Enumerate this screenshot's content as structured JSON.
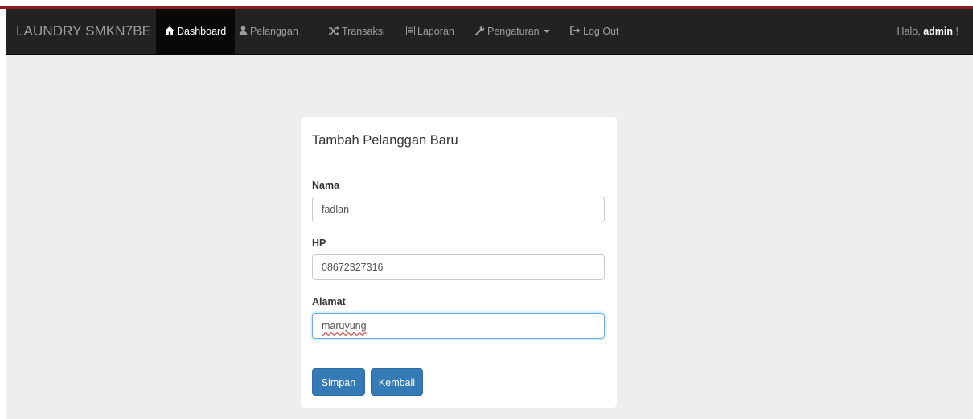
{
  "navbar": {
    "brand": "LAUNDRY SMKN7BE",
    "items": [
      {
        "label": "Dashboard",
        "icon": "home-icon",
        "glyph": "🏠",
        "active": true
      },
      {
        "label": "Pelanggan",
        "icon": "user-icon",
        "glyph": "👤",
        "active": false
      },
      {
        "label": "Transaksi",
        "icon": "random-icon",
        "glyph": "⤨",
        "active": false
      },
      {
        "label": "Laporan",
        "icon": "list-icon",
        "glyph": "▤",
        "active": false
      },
      {
        "label": "Pengaturan",
        "icon": "wrench-icon",
        "glyph": "🔧",
        "active": false,
        "dropdown": true
      },
      {
        "label": "Log Out",
        "icon": "logout-icon",
        "glyph": "⮕",
        "active": false
      }
    ],
    "greeting_prefix": "Halo,",
    "greeting_user": "admin",
    "greeting_suffix": "!"
  },
  "form": {
    "title": "Tambah Pelanggan Baru",
    "nama_label": "Nama",
    "nama_value": "fadlan",
    "hp_label": "HP",
    "hp_value": "08672327316",
    "alamat_label": "Alamat",
    "alamat_value": "maruyung",
    "save_label": "Simpan",
    "back_label": "Kembali"
  },
  "colors": {
    "navbar_bg": "#222222",
    "active_bg": "#080808",
    "primary": "#337ab7",
    "accent_top": "#8b1d1d"
  }
}
